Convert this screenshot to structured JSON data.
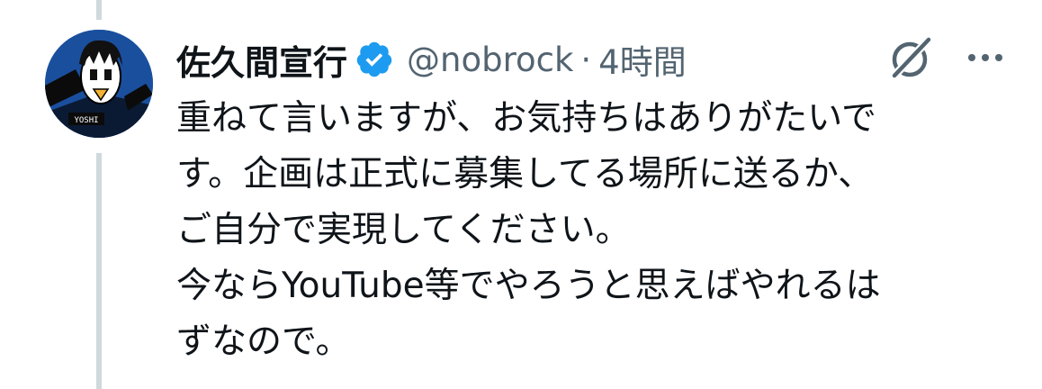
{
  "tweet": {
    "author": {
      "display_name": "佐久間宣行",
      "handle": "@nobrock",
      "verified": true,
      "avatar_icon": "user-avatar"
    },
    "separator": "·",
    "timestamp": "4時間",
    "text_lines": [
      "重ねて言いますが、お気持ちはありがたいで",
      "す。企画は正式に募集してる場所に送るか、",
      "ご自分で実現してください。",
      "今ならYouTube等でやろうと思えばやれるは",
      "ずなので。"
    ],
    "avatar_text": "YOSHI"
  },
  "icons": {
    "verified": "verified-badge-icon",
    "grok": "grok-icon",
    "more": "more-options-icon"
  },
  "colors": {
    "verified_blue": "#1d9bf0",
    "secondary_text": "#536471",
    "thread_line": "#cfd9de"
  }
}
